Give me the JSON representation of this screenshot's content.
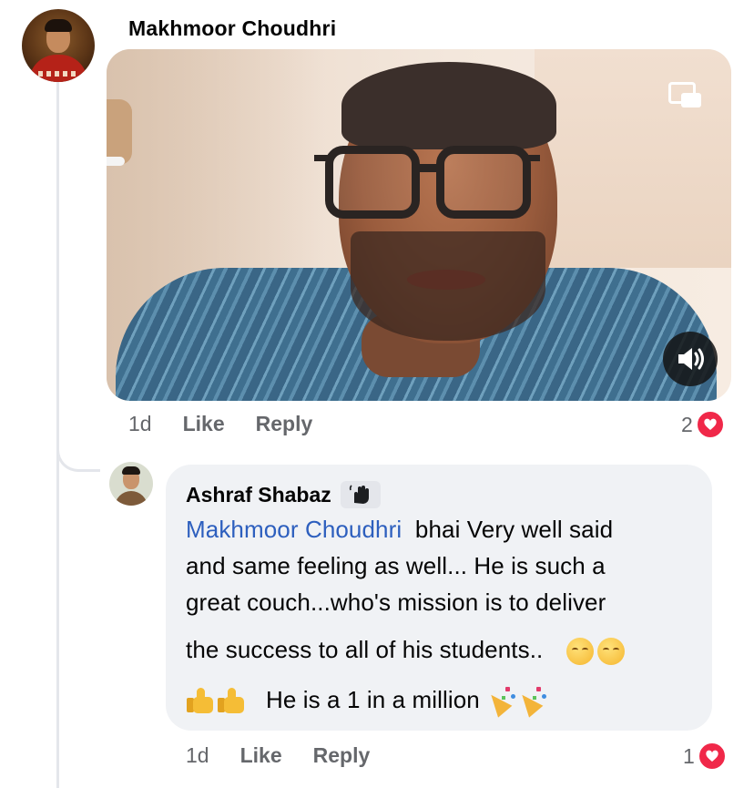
{
  "post_comment": {
    "author": "Makhmoor Choudhri",
    "time": "1d",
    "like_label": "Like",
    "reply_label": "Reply",
    "reaction_count": "2"
  },
  "reply_comment": {
    "author": "Ashraf Shabaz",
    "mention": "Makhmoor Choudhri",
    "lines": [
      "bhai Very well said",
      "and same feeling as well... He is such a",
      "great couch...who's mission is to deliver",
      "the success to all of his students..",
      "He is a 1 in a million"
    ],
    "time": "1d",
    "like_label": "Like",
    "reply_label": "Reply",
    "reaction_count": "1"
  },
  "icons": {
    "pip": "picture-in-picture-icon",
    "sound": "speaker-icon",
    "heart": "heart-reaction-icon",
    "wave": "waving-hand-badge-icon"
  },
  "colors": {
    "mention": "#2d5fbe",
    "heart": "#f02849",
    "meta": "#65676b",
    "bubble": "#f0f2f5"
  }
}
